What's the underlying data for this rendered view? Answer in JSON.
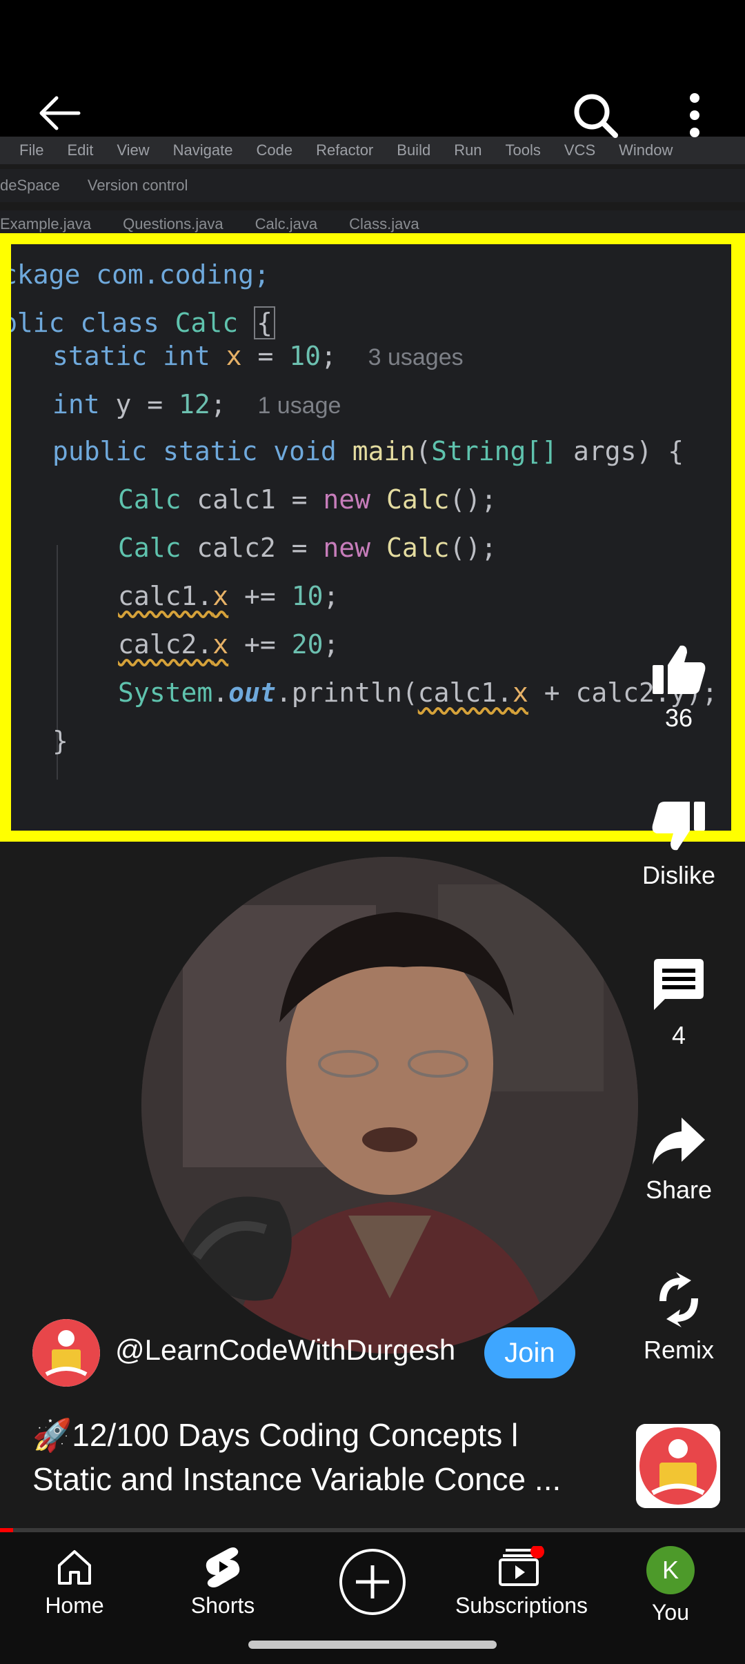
{
  "ide": {
    "menu": [
      "File",
      "Edit",
      "View",
      "Navigate",
      "Code",
      "Refactor",
      "Build",
      "Run",
      "Tools",
      "VCS",
      "Window"
    ],
    "workspace": "deSpace",
    "version_control": "Version control",
    "tabs": [
      "Example.java",
      "Questions.java",
      "Calc.java",
      "Class.java"
    ]
  },
  "code": {
    "l1": "ckage com.coding;",
    "l3a": "blic class ",
    "l3b": "Calc",
    "l3c": "{",
    "l4_hint": "3 usages",
    "l5_hint": "1 usage"
  },
  "actions": {
    "like_count": "36",
    "dislike_label": "Dislike",
    "comment_count": "4",
    "share_label": "Share",
    "remix_label": "Remix"
  },
  "channel": {
    "handle": "@LearnCodeWithDurgesh",
    "join_label": "Join"
  },
  "video": {
    "title_line1": "🚀12/100 Days Coding Concepts l",
    "title_line2": "Static and Instance Variable Conce ..."
  },
  "progress_fraction": 0.018,
  "nav": {
    "home": "Home",
    "shorts": "Shorts",
    "subscriptions": "Subscriptions",
    "you": "You",
    "you_initial": "K"
  },
  "colors": {
    "highlight_frame": "#ffff00",
    "join_button": "#3ea6ff",
    "progress": "#ff0000",
    "notification_dot": "#ff0000",
    "you_avatar": "#4d9a2a"
  }
}
